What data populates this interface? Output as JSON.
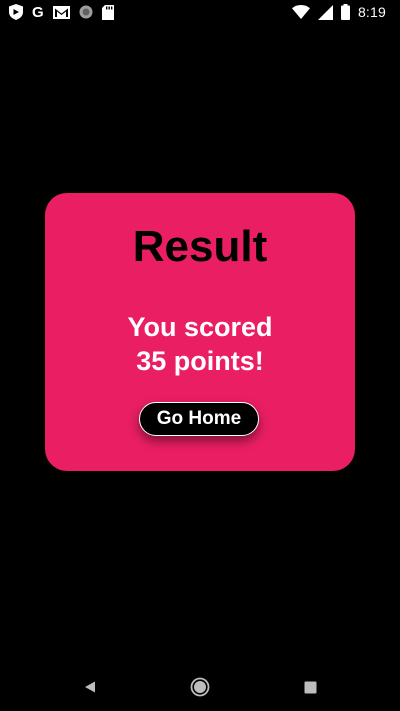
{
  "status_bar": {
    "time": "8:19",
    "left_icons": [
      "shield-icon",
      "google-icon",
      "gmail-icon",
      "circle-icon",
      "sd-card-icon"
    ],
    "right_icons": [
      "wifi-icon",
      "signal-icon",
      "battery-icon"
    ],
    "google_glyph": "G"
  },
  "result_card": {
    "title": "Result",
    "score_line_1": "You scored",
    "score_line_2": "35 points!",
    "button_label": "Go Home",
    "accent_color": "#E91E63"
  },
  "nav_bar": {
    "buttons": [
      "back-icon",
      "home-icon",
      "recents-icon"
    ]
  }
}
